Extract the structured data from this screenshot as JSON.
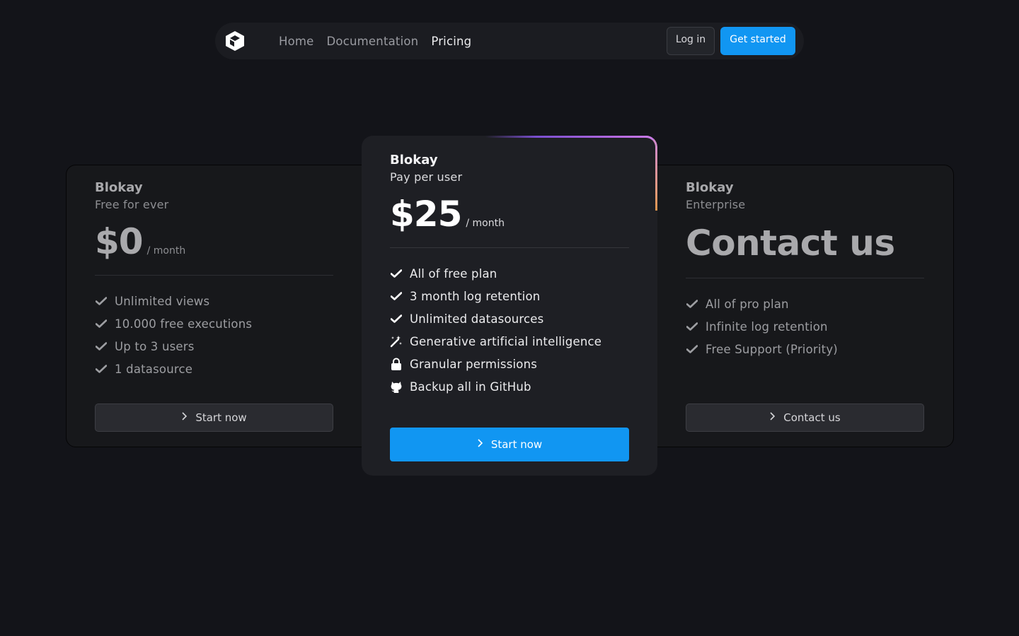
{
  "nav": {
    "links": [
      {
        "label": "Home",
        "active": false
      },
      {
        "label": "Documentation",
        "active": false
      },
      {
        "label": "Pricing",
        "active": true
      }
    ],
    "login_label": "Log in",
    "get_started_label": "Get started"
  },
  "plans": {
    "free": {
      "brand": "Blokay",
      "subtitle": "Free for ever",
      "price": "$0",
      "period": "/ month",
      "features": [
        "Unlimited views",
        "10.000 free executions",
        "Up to 3 users",
        "1 datasource"
      ],
      "cta": "Start now"
    },
    "pro": {
      "brand": "Blokay",
      "subtitle": "Pay per user",
      "price": "$25",
      "period": "/ month",
      "features": [
        {
          "icon": "check-icon",
          "label": "All of free plan"
        },
        {
          "icon": "check-icon",
          "label": "3 month log retention"
        },
        {
          "icon": "check-icon",
          "label": "Unlimited datasources"
        },
        {
          "icon": "magic-wand-icon",
          "label": "Generative artificial intelligence"
        },
        {
          "icon": "lock-icon",
          "label": "Granular permissions"
        },
        {
          "icon": "github-icon",
          "label": "Backup all in GitHub"
        }
      ],
      "cta": "Start now"
    },
    "enterprise": {
      "brand": "Blokay",
      "subtitle": "Enterprise",
      "price": "Contact us",
      "features": [
        "All of pro plan",
        "Infinite log retention",
        "Free Support (Priority)"
      ],
      "cta": "Contact us"
    }
  },
  "colors": {
    "accent": "#1196f2",
    "background": "#131419"
  }
}
